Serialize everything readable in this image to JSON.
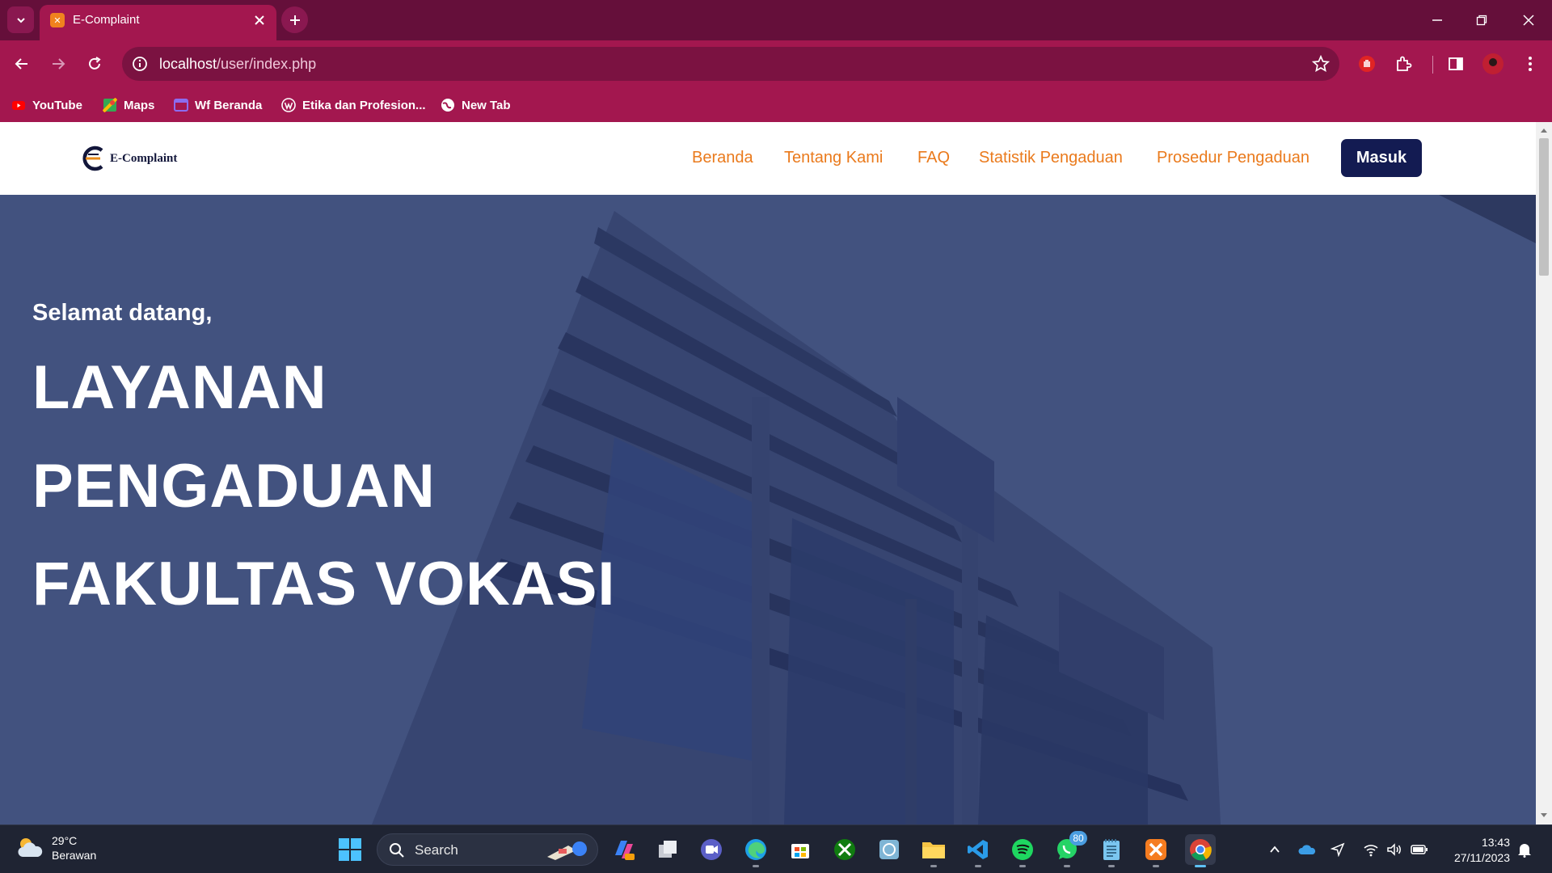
{
  "browser": {
    "tab": {
      "title": "E-Complaint"
    },
    "address_bar": {
      "url_host": "localhost",
      "url_path": "/user/index.php"
    },
    "bookmarks": [
      {
        "label": "YouTube",
        "icon": "youtube-icon",
        "color": "#ff0000"
      },
      {
        "label": "Maps",
        "icon": "maps-icon",
        "color": "#34a853"
      },
      {
        "label": "Wf Beranda",
        "icon": "webflow-icon",
        "color": "#6e4bd8"
      },
      {
        "label": "Etika dan Profesion...",
        "icon": "wordpress-icon",
        "color": "#ffffff"
      },
      {
        "label": "New Tab",
        "icon": "globe-icon",
        "color": "#ffffff"
      }
    ]
  },
  "site": {
    "logo_text": "E-Complaint",
    "nav": [
      "Beranda",
      "Tentang Kami",
      "FAQ",
      "Statistik Pengaduan",
      "Prosedur Pengaduan"
    ],
    "login_button": "Masuk",
    "hero": {
      "greeting": "Selamat datang,",
      "lines": [
        "LAYANAN",
        "PENGADUAN",
        "FAKULTAS VOKASI"
      ]
    }
  },
  "taskbar": {
    "weather": {
      "temp": "29°C",
      "condition": "Berawan"
    },
    "search_placeholder": "Search",
    "whatsapp_badge": "80",
    "clock": {
      "time": "13:43",
      "date": "27/11/2023"
    }
  },
  "colors": {
    "tab_strip": "#650f3a",
    "toolbar": "#a3174f",
    "nav_link": "#ea7a1c",
    "login_button": "#131b52",
    "hero_tint": "#4a5a86"
  }
}
